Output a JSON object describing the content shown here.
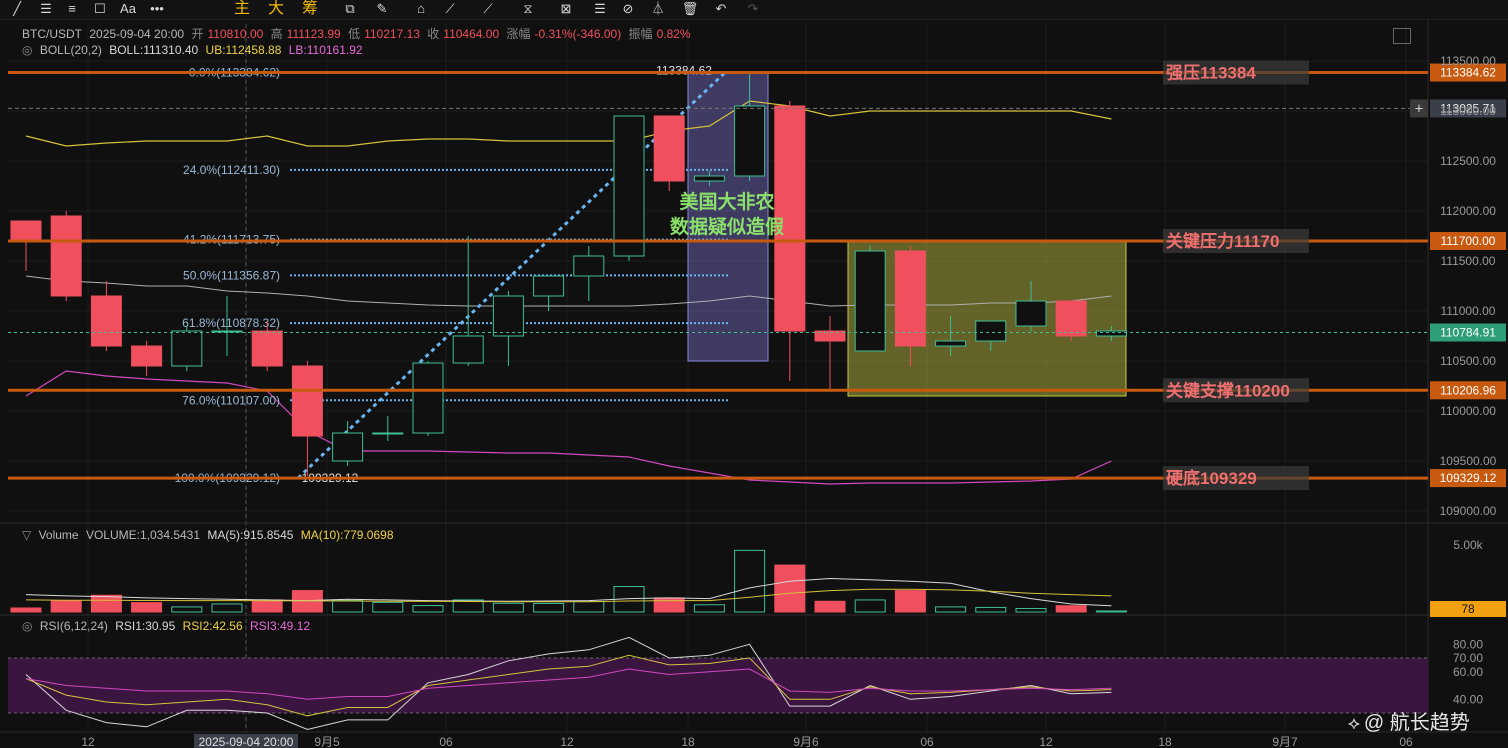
{
  "toolbar": {
    "tools": [
      "╱",
      "☰",
      "≡",
      "☐",
      "Aa",
      "•••",
      "主",
      "大",
      "筹",
      "⧉",
      "✎",
      "⌂",
      "⟋",
      "⟋",
      "⧖",
      "⊠",
      "☰",
      "⊘",
      "⏃",
      "🗑",
      "↶",
      "↷"
    ]
  },
  "legend": {
    "symbol": "BTC/USDT",
    "datetime": "2025-09-04 20:00",
    "open_label": "开",
    "open": "110810.00",
    "high_label": "高",
    "high": "111123.99",
    "low_label": "低",
    "low": "110217.13",
    "close_label": "收",
    "close": "110464.00",
    "chg_label": "涨幅",
    "chg": "-0.31%(-346.00)",
    "amp_label": "振幅",
    "amp": "0.82%",
    "boll_name": "BOLL(20,2)",
    "boll_mid": "BOLL:111310.40",
    "boll_ub": "UB:112458.88",
    "boll_lb": "LB:110161.92",
    "vol_name": "Volume",
    "vol_value": "VOLUME:1,034.5431",
    "vol_ma5": "MA(5):915.8545",
    "vol_ma10": "MA(10):779.0698",
    "rsi_name": "RSI(6,12,24)",
    "rsi1": "RSI1:30.95",
    "rsi2": "RSI2:42.56",
    "rsi3": "RSI3:49.12"
  },
  "watermark": "@ 航长趋势",
  "chart_data": {
    "type": "candlestick",
    "colors": {
      "up": "#3fbf93",
      "down": "#f0505e",
      "level_line": "#c85a10",
      "fib": "#6ab4f0",
      "boll_ub": "#d6c23a",
      "boll_mid": "#b0b0b0",
      "boll_lb": "#d248c0",
      "box": "#c8c84a",
      "annotation": "#8ae06a",
      "level_label": "#f07070",
      "rsi_band": "#3a1540"
    },
    "ylim": [
      109000,
      113650
    ],
    "y_ticks": [
      "113500.00",
      "113000.00",
      "112500.00",
      "112000.00",
      "111500.00",
      "111000.00",
      "110500.00",
      "110000.00",
      "109500.00",
      "109000.00"
    ],
    "x_ticks": [
      "12",
      "2025-09-04 20:00",
      "9月5",
      "06",
      "12",
      "18",
      "9月6",
      "06",
      "12",
      "18",
      "9月7",
      "06"
    ],
    "candles": [
      {
        "o": 111900,
        "h": 111900,
        "l": 111400,
        "c": 111700
      },
      {
        "o": 111950,
        "h": 112000,
        "l": 111100,
        "c": 111150
      },
      {
        "o": 111150,
        "h": 111300,
        "l": 110600,
        "c": 110650
      },
      {
        "o": 110650,
        "h": 110700,
        "l": 110350,
        "c": 110450
      },
      {
        "o": 110450,
        "h": 110850,
        "l": 110400,
        "c": 110800
      },
      {
        "o": 110800,
        "h": 111150,
        "l": 110550,
        "c": 110800
      },
      {
        "o": 110800,
        "h": 110900,
        "l": 110400,
        "c": 110450
      },
      {
        "o": 110450,
        "h": 110500,
        "l": 109350,
        "c": 109750
      },
      {
        "o": 109500,
        "h": 109900,
        "l": 109450,
        "c": 109780
      },
      {
        "o": 109780,
        "h": 109950,
        "l": 109700,
        "c": 109780
      },
      {
        "o": 109780,
        "h": 110500,
        "l": 109750,
        "c": 110480
      },
      {
        "o": 110480,
        "h": 111750,
        "l": 110450,
        "c": 110750
      },
      {
        "o": 110750,
        "h": 111200,
        "l": 110450,
        "c": 111150
      },
      {
        "o": 111150,
        "h": 111300,
        "l": 111000,
        "c": 111350
      },
      {
        "o": 111350,
        "h": 111650,
        "l": 111100,
        "c": 111550
      },
      {
        "o": 111550,
        "h": 112950,
        "l": 111500,
        "c": 112950
      },
      {
        "o": 112950,
        "h": 112950,
        "l": 112200,
        "c": 112300
      },
      {
        "o": 112300,
        "h": 112400,
        "l": 112250,
        "c": 112350
      },
      {
        "o": 112350,
        "h": 113384.62,
        "l": 112300,
        "c": 113050
      },
      {
        "o": 113050,
        "h": 113100,
        "l": 110300,
        "c": 110800
      },
      {
        "o": 110800,
        "h": 110950,
        "l": 110200,
        "c": 110700
      },
      {
        "o": 110600,
        "h": 111650,
        "l": 110600,
        "c": 111600
      },
      {
        "o": 111600,
        "h": 111650,
        "l": 110450,
        "c": 110650
      },
      {
        "o": 110650,
        "h": 110950,
        "l": 110550,
        "c": 110700
      },
      {
        "o": 110700,
        "h": 110900,
        "l": 110600,
        "c": 110900
      },
      {
        "o": 110850,
        "h": 111300,
        "l": 110800,
        "c": 111100
      },
      {
        "o": 111100,
        "h": 111100,
        "l": 110700,
        "c": 110750
      },
      {
        "o": 110750,
        "h": 110850,
        "l": 110700,
        "c": 110800
      }
    ],
    "boll_ub": [
      112750,
      112650,
      112680,
      112700,
      112700,
      112700,
      112750,
      112650,
      112650,
      112700,
      112720,
      112720,
      112700,
      112700,
      112700,
      112700,
      112800,
      112850,
      113100,
      113050,
      112950,
      113000,
      113000,
      113000,
      113000,
      113000,
      113000,
      112920
    ],
    "boll_mid": [
      111350,
      111300,
      111280,
      111250,
      111250,
      111200,
      111180,
      111150,
      111100,
      111080,
      111060,
      111050,
      111050,
      111050,
      111050,
      111050,
      111070,
      111100,
      111150,
      111100,
      111050,
      111060,
      111060,
      111060,
      111080,
      111080,
      111100,
      111150
    ],
    "boll_lb": [
      110150,
      110400,
      110350,
      110320,
      110300,
      110280,
      110200,
      109800,
      109600,
      109600,
      109600,
      109590,
      109580,
      109580,
      109560,
      109540,
      109450,
      109380,
      109310,
      109290,
      109270,
      109280,
      109280,
      109280,
      109290,
      109300,
      109320,
      109500
    ],
    "fib_levels": [
      {
        "label": "0.0%(113384.62)",
        "value": 113384.62
      },
      {
        "label": "24.0%(112411.30)",
        "value": 112411.3
      },
      {
        "label": "41.2%(111713.75)",
        "value": 111713.75
      },
      {
        "label": "50.0%(111356.87)",
        "value": 111356.87
      },
      {
        "label": "61.8%(110878.32)",
        "value": 110878.32
      },
      {
        "label": "76.0%(110107.00)",
        "value": 110107.0
      },
      {
        "label": "100.0%(109329.12)",
        "value": 109329.12
      }
    ],
    "fib_high_label": "113384.62",
    "fib_low_label": "109329.12",
    "key_levels": [
      {
        "label": "强压113384",
        "value": 113384.62,
        "price": "113384.62"
      },
      {
        "label": "关键压力11170",
        "value": 111700.0,
        "price": "111700.00"
      },
      {
        "label": "关键支撑110200",
        "value": 110206.96,
        "price": "110206.96"
      },
      {
        "label": "硬底109329",
        "value": 109329.12,
        "price": "109329.12"
      }
    ],
    "crosshair_price": "113025.71",
    "crosshair_value": 113025.71,
    "current_price": "110784.91",
    "current_value": 110784.91,
    "annotation": [
      "美国大非农",
      "数据疑似造假"
    ],
    "volume": {
      "values": [
        300,
        820,
        1250,
        700,
        380,
        600,
        900,
        1600,
        860,
        720,
        480,
        900,
        650,
        640,
        780,
        1900,
        1050,
        540,
        4600,
        3500,
        800,
        900,
        1600,
        380,
        340,
        260,
        470,
        80
      ],
      "ma5": [
        1300,
        1200,
        1150,
        1050,
        1000,
        950,
        900,
        850,
        950,
        900,
        850,
        820,
        800,
        820,
        850,
        1000,
        1050,
        1000,
        1800,
        2300,
        2500,
        2400,
        2300,
        2150,
        1500,
        1000,
        600,
        460
      ],
      "ma10": [
        900,
        880,
        870,
        860,
        850,
        850,
        840,
        830,
        820,
        800,
        790,
        780,
        760,
        760,
        770,
        820,
        850,
        850,
        1100,
        1400,
        1600,
        1700,
        1700,
        1650,
        1550,
        1400,
        1300,
        1200
      ],
      "ylim": [
        0,
        6000
      ],
      "y_tick": "5.00k",
      "current": "78"
    },
    "rsi": {
      "ylim": [
        15,
        92
      ],
      "y_ticks": [
        "80.00",
        "70.00",
        "60.00",
        "40.00"
      ],
      "band": [
        30,
        70
      ],
      "rsi1": [
        58,
        32,
        23,
        20,
        32,
        32,
        30,
        18,
        25,
        25,
        52,
        58,
        68,
        73,
        76,
        85,
        70,
        72,
        80,
        35,
        35,
        50,
        40,
        42,
        46,
        50,
        44,
        45
      ],
      "rsi2": [
        55,
        43,
        38,
        36,
        38,
        40,
        36,
        28,
        34,
        34,
        50,
        54,
        58,
        62,
        64,
        72,
        65,
        66,
        70,
        40,
        40,
        49,
        44,
        45,
        47,
        49,
        46,
        47
      ],
      "rsi3": [
        55,
        50,
        48,
        46,
        46,
        46,
        44,
        40,
        42,
        42,
        48,
        50,
        52,
        54,
        56,
        62,
        58,
        60,
        62,
        46,
        45,
        48,
        46,
        46,
        47,
        48,
        47,
        48
      ]
    }
  }
}
